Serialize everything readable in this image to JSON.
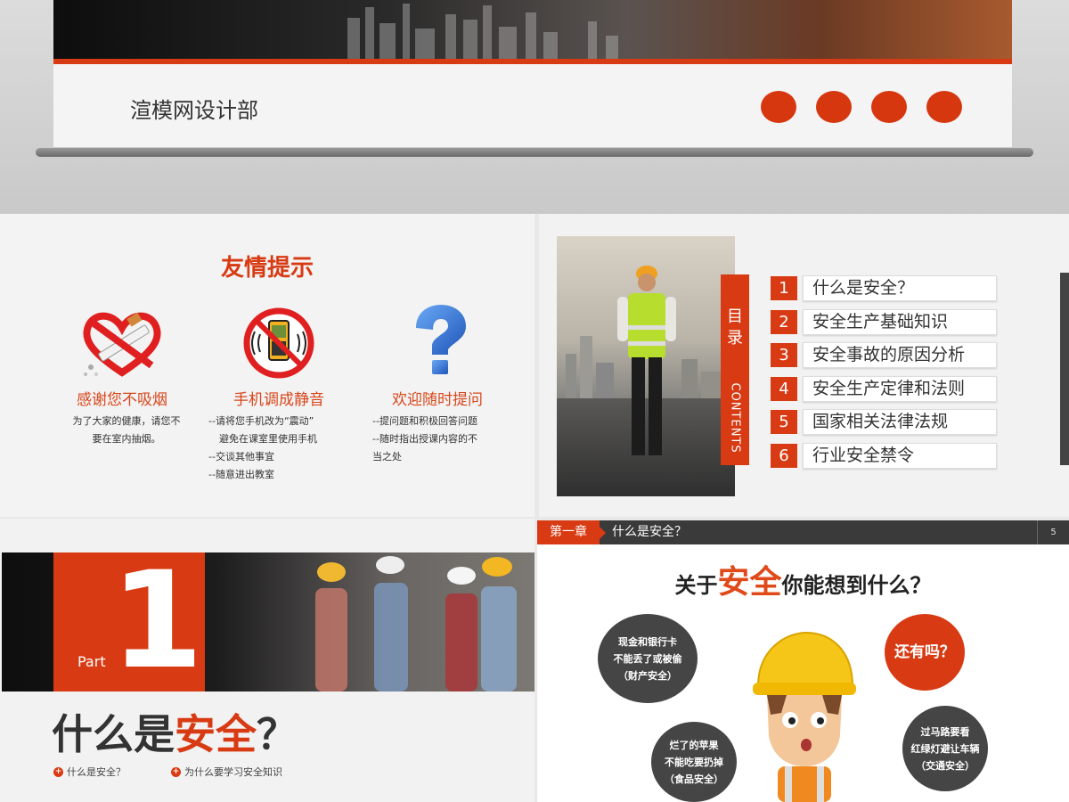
{
  "slide_top": {
    "department": "渲模网设计部"
  },
  "slide_tips": {
    "title": "友情提示",
    "items": [
      {
        "heading": "感谢您不吸烟",
        "lines": [
          "为了大家的健康，请您不",
          "要在室内抽烟。"
        ],
        "icon": "no-smoking-icon"
      },
      {
        "heading": "手机调成静音",
        "lines": [
          "--请将您手机改为“震动”",
          "避免在课室里使用手机",
          "--交谈其他事宜",
          "--随意进出教室"
        ],
        "icon": "no-phone-icon"
      },
      {
        "heading": "欢迎随时提问",
        "lines": [
          "--提问题和积极回答问题",
          "--随时指出授课内容的不",
          "当之处"
        ],
        "icon": "question-mark-icon"
      }
    ]
  },
  "slide_toc": {
    "label_cn": "目录",
    "label_en": "CONTENTS",
    "items": [
      {
        "num": "1",
        "label": "什么是安全？"
      },
      {
        "num": "2",
        "label": "安全生产基础知识"
      },
      {
        "num": "3",
        "label": "安全事故的原因分析"
      },
      {
        "num": "4",
        "label": "安全生产定律和法则"
      },
      {
        "num": "5",
        "label": "国家相关法律法规"
      },
      {
        "num": "6",
        "label": "行业安全禁令"
      }
    ]
  },
  "slide_part": {
    "part_label": "Part",
    "part_number": "1",
    "heading_prefix": "什么是",
    "heading_highlight": "安全",
    "heading_suffix": "？",
    "subtopics": [
      "什么是安全？",
      "为什么要学习安全知识"
    ]
  },
  "slide_chapter": {
    "chapter_tag": "第一章",
    "chapter_title": "什么是安全？",
    "page_number": "5",
    "question_prefix": "关于",
    "question_highlight": "安全",
    "question_suffix": "你能想到什么？",
    "bubble_money": [
      "现金和银行卡",
      "不能丢了或被偷",
      "（财产安全）"
    ],
    "bubble_more": "还有吗？",
    "bubble_food": [
      "烂了的苹果",
      "不能吃要扔掉",
      "（食品安全）"
    ],
    "bubble_traffic": [
      "过马路要看",
      "红绿灯避让车辆",
      "（交通安全）"
    ]
  },
  "colors": {
    "accent": "#d83b13",
    "dark": "#3a3a3a"
  }
}
